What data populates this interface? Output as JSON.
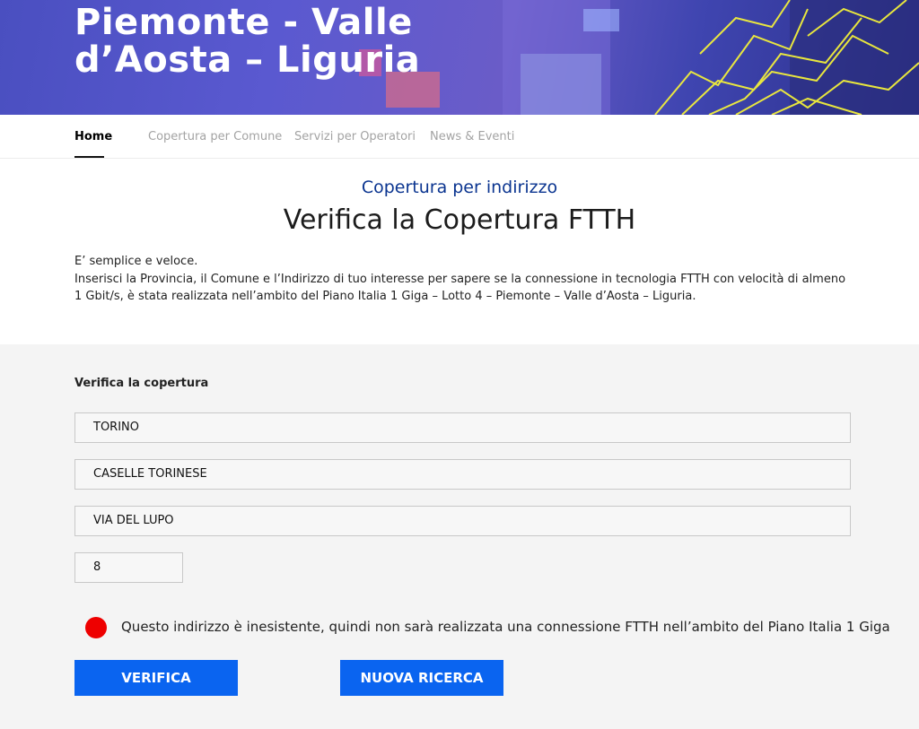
{
  "hero": {
    "title": "Piemonte - Valle d’Aosta – Liguria"
  },
  "nav": {
    "items": [
      {
        "label": "Home",
        "active": true
      },
      {
        "label": "Copertura per Comune",
        "active": false
      },
      {
        "label": "Servizi per Operatori",
        "active": false
      },
      {
        "label": "News & Eventi",
        "active": false
      }
    ]
  },
  "intro": {
    "subtitle": "Copertura per indirizzo",
    "title": "Verifica la Copertura FTTH",
    "line1": "E’ semplice e veloce.",
    "line2": "Inserisci la Provincia, il Comune e l’Indirizzo di tuo interesse per sapere se la connessione in tecnologia FTTH con velocità di almeno 1 Gbit/s, è stata realizzata nell’ambito del Piano Italia 1 Giga – Lotto 4 – Piemonte – Valle d’Aosta – Liguria."
  },
  "form": {
    "label": "Verifica la copertura",
    "provincia": "TORINO",
    "comune": "CASELLE TORINESE",
    "indirizzo": "VIA DEL LUPO",
    "civico": "8"
  },
  "result": {
    "status_color": "#ee0000",
    "message": "Questo indirizzo è inesistente, quindi non sarà realizzata una connessione FTTH nell’ambito del Piano Italia 1 Giga"
  },
  "buttons": {
    "verifica": "VERIFICA",
    "nuova_ricerca": "NUOVA RICERCA"
  },
  "colors": {
    "accent_blue": "#0a64f0",
    "subtitle_blue": "#0b3590",
    "status_red": "#ee0000"
  }
}
